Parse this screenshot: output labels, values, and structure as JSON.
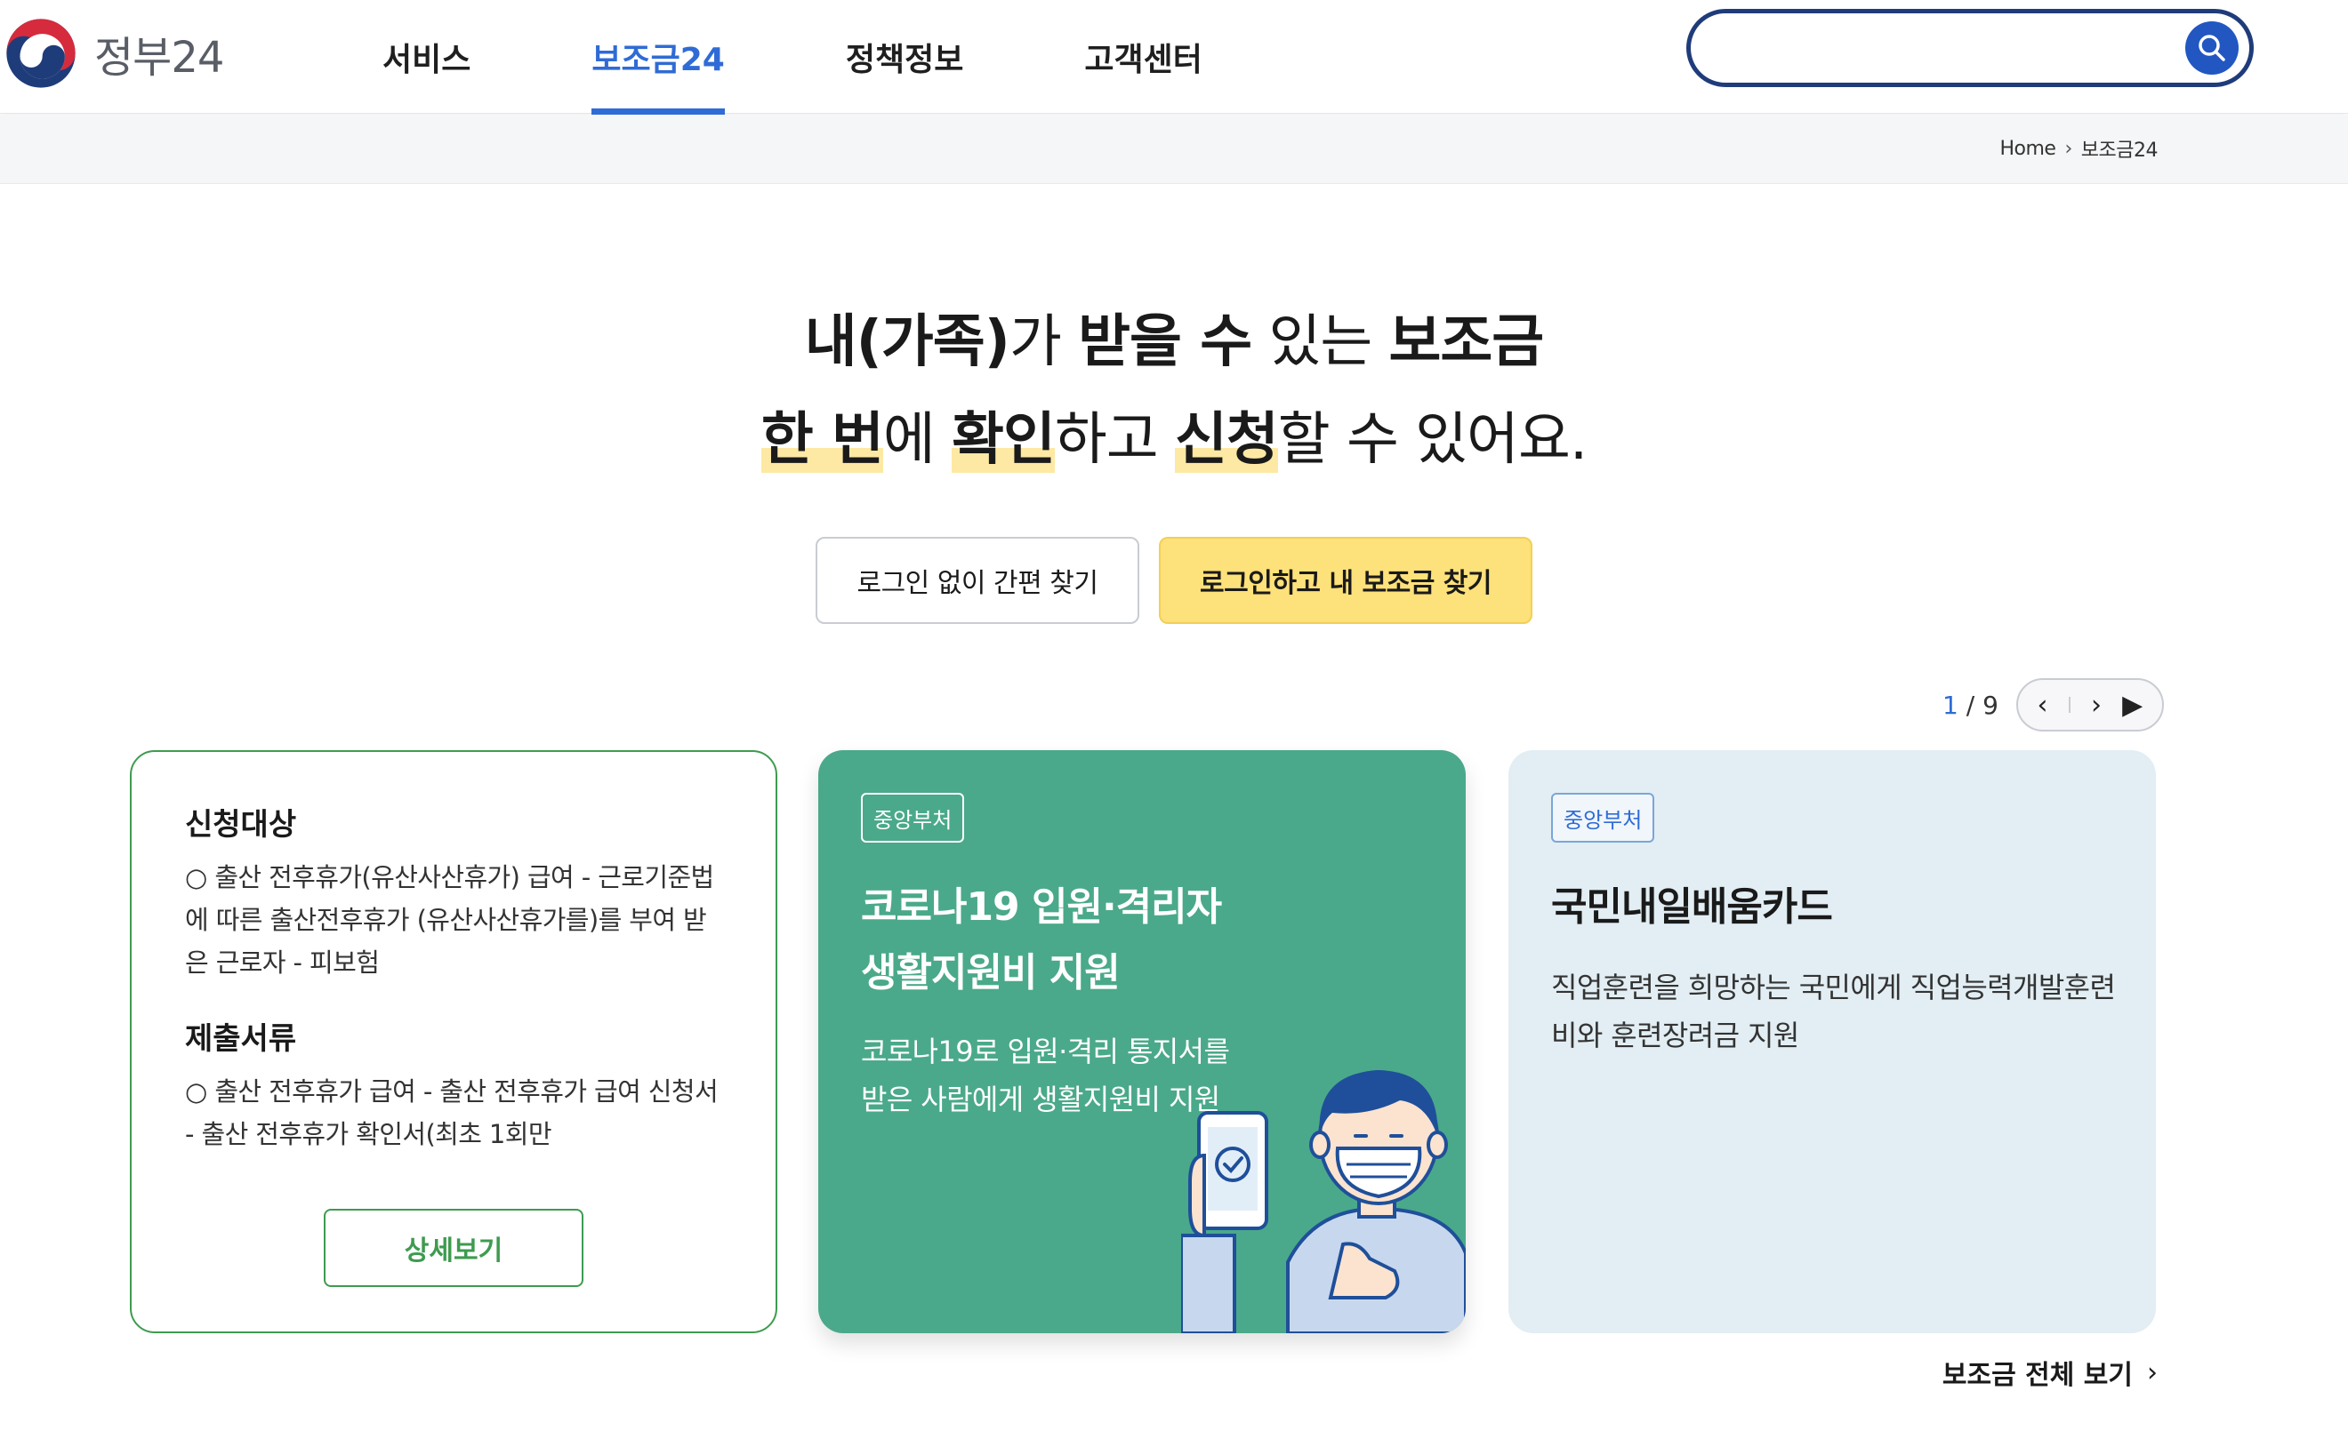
{
  "header": {
    "logo_text": "정부24",
    "nav": [
      {
        "label": "서비스",
        "active": false
      },
      {
        "label": "보조금24",
        "active": true
      },
      {
        "label": "정책정보",
        "active": false
      },
      {
        "label": "고객센터",
        "active": false
      }
    ],
    "search": {
      "value": "",
      "placeholder": ""
    }
  },
  "breadcrumb": {
    "home": "Home",
    "current": "보조금24"
  },
  "hero": {
    "line1": {
      "p1": "내(가족)",
      "p2": "가 ",
      "p3": "받을 수",
      "p4": " 있는 ",
      "p5": "보조금"
    },
    "line2": {
      "p1": "한 번",
      "p2": "에 ",
      "p3": "확인",
      "p4": "하고 ",
      "p5": "신청",
      "p6": "할 수 있어요."
    }
  },
  "cta": {
    "guest": "로그인 없이 간편 찾기",
    "login": "로그인하고 내 보조금 찾기"
  },
  "pager": {
    "current": "1",
    "total": "9"
  },
  "cards": {
    "card1": {
      "target_title": "신청대상",
      "target_text": "○ 출산 전후휴가(유산사산휴가) 급여 - 근로기준법에 따른 출산전후휴가 (유산사산휴가를)를 부여 받은 근로자 - 피보험",
      "docs_title": "제출서류",
      "docs_text": "○ 출산 전후휴가 급여 - 출산 전후휴가 급여 신청서 - 출산 전후휴가 확인서(최초 1회만",
      "detail_button": "상세보기"
    },
    "card2": {
      "badge": "중앙부처",
      "title_line1": "코로나19 입원·격리자",
      "title_line2": "생활지원비 지원",
      "desc": "코로나19로 입원·격리 통지서를 받은 사람에게 생활지원비 지원"
    },
    "card3": {
      "badge": "중앙부처",
      "title": "국민내일배움카드",
      "desc": "직업훈련을 희망하는 국민에게 직업능력개발훈련비와 훈련장려금 지원"
    }
  },
  "all_link": "보조금 전체 보기",
  "colors": {
    "brand_blue": "#2f6bd6",
    "search_border": "#1f3c7a",
    "primary_yellow": "#fde17a",
    "green": "#3e9b4f",
    "teal_card": "#4aa98a",
    "light_card": "#e2eef3"
  }
}
